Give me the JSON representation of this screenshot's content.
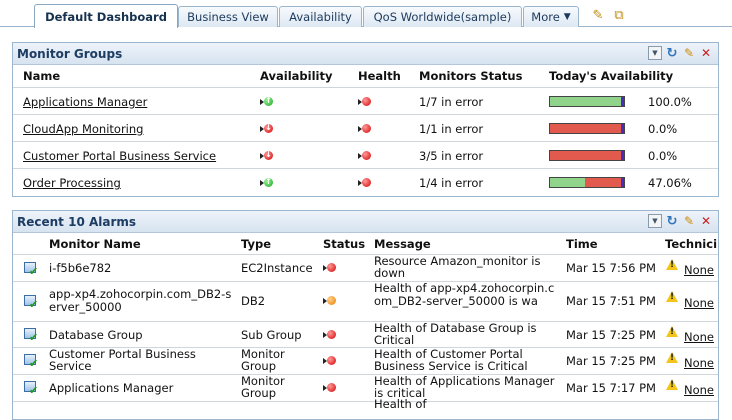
{
  "tabs": {
    "default_dashboard": "Default Dashboard",
    "business_view": "Business View",
    "availability": "Availability",
    "qos": "QoS Worldwide(sample)",
    "more": "More"
  },
  "monitor_groups": {
    "title": "Monitor Groups",
    "columns": {
      "name": "Name",
      "availability": "Availability",
      "health": "Health",
      "monitors_status": "Monitors Status",
      "todays_availability": "Today's Availability"
    },
    "rows": [
      {
        "name": "Applications Manager",
        "availability": "up",
        "health": "critical",
        "monitors_status": "1/7 in error",
        "pct_text": "100.0%",
        "pct": 100
      },
      {
        "name": "CloudApp Monitoring",
        "availability": "down",
        "health": "critical",
        "monitors_status": "1/1 in error",
        "pct_text": "0.0%",
        "pct": 0
      },
      {
        "name": "Customer Portal Business Service",
        "availability": "down",
        "health": "critical",
        "monitors_status": "3/5 in error",
        "pct_text": "0.0%",
        "pct": 0
      },
      {
        "name": "Order Processing",
        "availability": "up",
        "health": "critical",
        "monitors_status": "1/4 in error",
        "pct_text": "47.06%",
        "pct": 47.06
      }
    ]
  },
  "recent_alarms": {
    "title": "Recent 10 Alarms",
    "columns": {
      "monitor_name": "Monitor Name",
      "type": "Type",
      "status": "Status",
      "message": "Message",
      "time": "Time",
      "technician": "Technici"
    },
    "rows": [
      {
        "monitor": "i-f5b6e782",
        "type": "EC2Instance",
        "status": "critical",
        "message": "Resource Amazon_monitor is down",
        "time": "Mar 15 7:56 PM",
        "technician": "None"
      },
      {
        "monitor": "app-xp4.zohocorpin.com_DB2-server_50000",
        "type": "DB2",
        "status": "warning",
        "message": "Health of app-xp4.zohocorpin.com_DB2-server_50000 is wa",
        "time": "Mar 15 7:51 PM",
        "technician": "None"
      },
      {
        "monitor": "Database Group",
        "type": "Sub Group",
        "status": "critical",
        "message": "Health of Database Group is Critical",
        "time": "Mar 15 7:25 PM",
        "technician": "None"
      },
      {
        "monitor": "Customer Portal Business Service",
        "type": "Monitor Group",
        "status": "critical",
        "message": "Health of Customer Portal Business Service is Critical",
        "time": "Mar 15 7:25 PM",
        "technician": "None"
      },
      {
        "monitor": "Applications Manager",
        "type": "Monitor Group",
        "status": "critical",
        "message": "Health of Applications Manager is critical",
        "time": "Mar 15 7:17 PM",
        "technician": "None"
      }
    ],
    "partial_next_message": "Health of"
  },
  "icons": {
    "tab_icon_1": "customize-tab-icon",
    "tab_icon_2": "new-tab-icon",
    "panel_tools": [
      "dropdown-icon",
      "refresh-icon",
      "edit-icon",
      "close-icon"
    ]
  },
  "colors": {
    "bar_green": "#8fd48a",
    "bar_red": "#e25a4e",
    "bar_end": "#4b2bb8",
    "panel_border": "#9cb6cf"
  }
}
